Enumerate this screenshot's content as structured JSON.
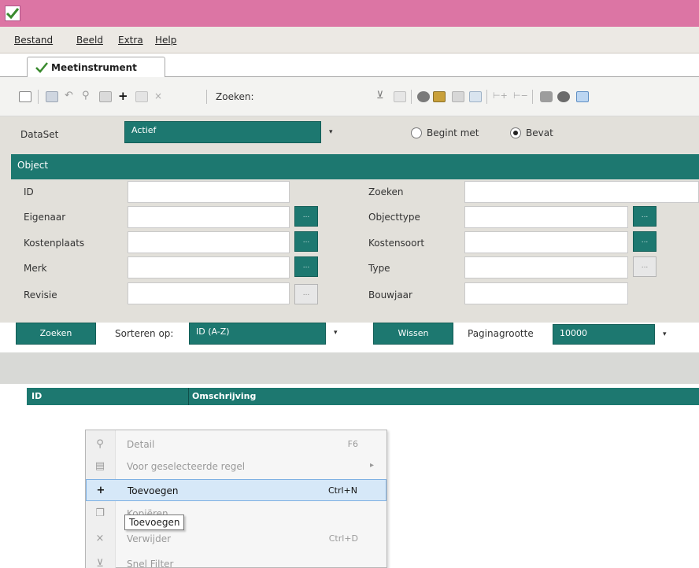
{
  "menu": {
    "items": [
      "Bestand",
      "Beeld",
      "Extra",
      "Help"
    ]
  },
  "tab": {
    "label": "Meetinstrument"
  },
  "toolbar": {
    "search_label": "Zoeken:"
  },
  "filter": {
    "dataset_label": "DataSet",
    "dataset_value": "Actief",
    "radio_begint_met": "Begint met",
    "radio_bevat": "Bevat",
    "selected_radio": "Bevat"
  },
  "object_section": {
    "title": "Object",
    "left_fields": [
      {
        "label": "ID",
        "value": ""
      },
      {
        "label": "Eigenaar",
        "value": ""
      },
      {
        "label": "Kostenplaats",
        "value": ""
      },
      {
        "label": "Merk",
        "value": ""
      },
      {
        "label": "Revisie",
        "value": ""
      }
    ],
    "right_fields": [
      {
        "label": "Zoeken",
        "value": ""
      },
      {
        "label": "Objecttype",
        "value": ""
      },
      {
        "label": "Kostensoort",
        "value": ""
      },
      {
        "label": "Type",
        "value": ""
      },
      {
        "label": "Bouwjaar",
        "value": ""
      }
    ],
    "lookup_label": "..."
  },
  "actions": {
    "search_button": "Zoeken",
    "sort_label": "Sorteren op:",
    "sort_value": "ID (A-Z)",
    "clear_button": "Wissen",
    "pagesize_label": "Paginagrootte",
    "pagesize_value": "10000"
  },
  "grid": {
    "columns": [
      "ID",
      "Omschrijving"
    ]
  },
  "context_menu": {
    "items": [
      {
        "label": "Detail",
        "shortcut": "F6",
        "icon": "magnifier-icon",
        "enabled": false
      },
      {
        "label": "Voor geselecteerde regel",
        "shortcut": "",
        "submenu": true,
        "icon": "record-icon",
        "enabled": false
      },
      {
        "label": "Toevoegen",
        "shortcut": "Ctrl+N",
        "icon": "plus-icon",
        "enabled": true,
        "highlighted": true
      },
      {
        "label": "Kopiëren",
        "shortcut": "",
        "icon": "copy-icon",
        "enabled": false
      },
      {
        "label": "Verwijder",
        "shortcut": "Ctrl+D",
        "icon": "delete-icon",
        "enabled": false
      },
      {
        "label": "Snel Filter",
        "shortcut": "",
        "icon": "filter-icon",
        "enabled": false
      }
    ],
    "tooltip": "Toevoegen"
  },
  "colors": {
    "titlebar": "#dc75a4",
    "accent_teal": "#1d7870",
    "menu_highlight": "#d6e8f8"
  }
}
